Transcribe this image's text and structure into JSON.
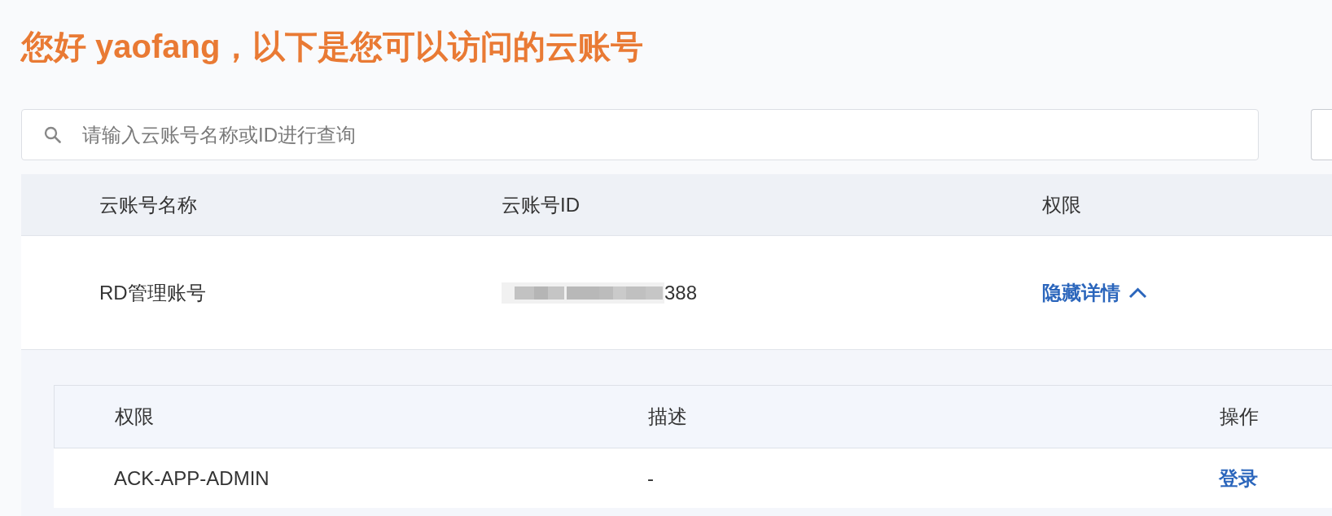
{
  "greeting": "您好 yaofang，以下是您可以访问的云账号",
  "search": {
    "placeholder": "请输入云账号名称或ID进行查询"
  },
  "table": {
    "columns": [
      "云账号名称",
      "云账号ID",
      "权限"
    ],
    "rows": [
      {
        "name": "RD管理账号",
        "id": "388",
        "id_redacted": true,
        "toggle_label": "隐藏详情",
        "expanded": true,
        "permissions": {
          "columns": [
            "权限",
            "描述",
            "操作"
          ],
          "rows": [
            {
              "permission": "ACK-APP-ADMIN",
              "description": "-",
              "action": "登录"
            }
          ]
        }
      }
    ]
  }
}
